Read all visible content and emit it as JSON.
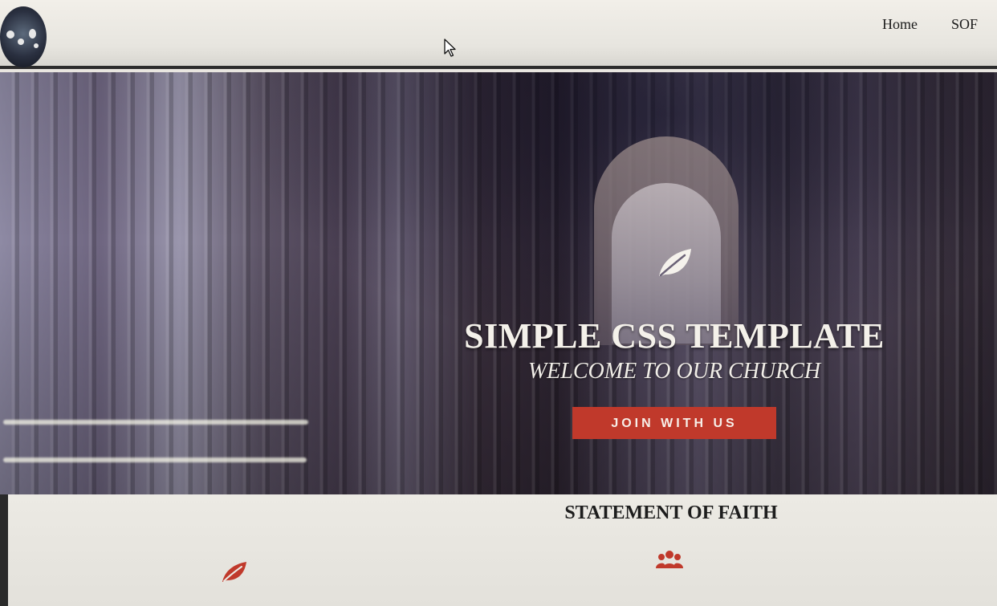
{
  "nav": {
    "links": [
      {
        "label": "Home"
      },
      {
        "label": "SOF"
      }
    ]
  },
  "hero": {
    "icon": "leaf-icon",
    "title": "SIMPLE CSS TEMPLATE",
    "subtitle": "WELCOME TO OUR CHURCH",
    "button_label": "JOIN WITH US"
  },
  "statement": {
    "title": "STATEMENT OF FAITH",
    "icons": [
      "leaf-icon",
      "users-icon"
    ]
  },
  "colors": {
    "accent": "#c0392b",
    "header_bg": "#eae8e2",
    "hero_text": "#f4f1ea"
  }
}
